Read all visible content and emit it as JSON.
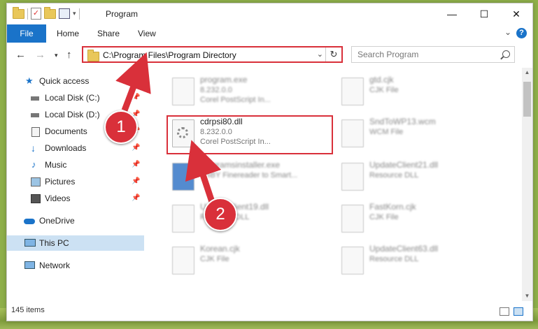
{
  "window": {
    "title": "Program"
  },
  "ribbon": {
    "file": "File",
    "tabs": [
      "Home",
      "Share",
      "View"
    ]
  },
  "nav": {
    "address": "C:\\Program Files\\Program Directory",
    "search_placeholder": "Search Program"
  },
  "sidebar": {
    "quick_access": "Quick access",
    "items": [
      {
        "label": "Local Disk (C:)",
        "icon": "drive-icon"
      },
      {
        "label": "Local Disk (D:)",
        "icon": "drive-icon"
      },
      {
        "label": "Documents",
        "icon": "documents-icon"
      },
      {
        "label": "Downloads",
        "icon": "downloads-icon"
      },
      {
        "label": "Music",
        "icon": "music-icon"
      },
      {
        "label": "Pictures",
        "icon": "pictures-icon"
      },
      {
        "label": "Videos",
        "icon": "videos-icon"
      }
    ],
    "onedrive": "OneDrive",
    "this_pc": "This PC",
    "network": "Network"
  },
  "files": [
    {
      "name": "program.exe",
      "line2": "8.232.0.0",
      "line3": "Corel PostScript In..."
    },
    {
      "name": "gtd.cjk",
      "line2": "CJK File",
      "line3": ""
    },
    {
      "name": "cdrpsi80.dll",
      "line2": "8.232.0.0",
      "line3": "Corel PostScript In..."
    },
    {
      "name": "SndToWP13.wcm",
      "line2": "WCM File",
      "line3": ""
    },
    {
      "name": "programsinstaller.exe",
      "line2": "ABBY Finereader to Smart...",
      "line3": ""
    },
    {
      "name": "UpdateClient21.dll",
      "line2": "Resource DLL",
      "line3": ""
    },
    {
      "name": "UpdateClient19.dll",
      "line2": "Resource DLL",
      "line3": ""
    },
    {
      "name": "FastKorn.cjk",
      "line2": "CJK File",
      "line3": ""
    },
    {
      "name": "Korean.cjk",
      "line2": "CJK File",
      "line3": ""
    },
    {
      "name": "UpdateClient63.dll",
      "line2": "Resource DLL",
      "line3": ""
    }
  ],
  "status": {
    "items": "145 items"
  },
  "annotations": {
    "step1": "1",
    "step2": "2"
  },
  "colors": {
    "accent": "#1a73c9",
    "highlight": "#d9303a",
    "selected": "#cce1f3"
  }
}
